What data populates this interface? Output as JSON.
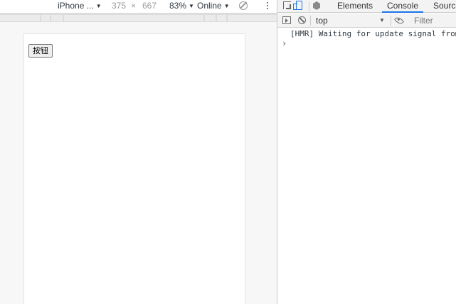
{
  "device_toolbar": {
    "device": "iPhone ...",
    "width": "375",
    "times": "×",
    "height": "667",
    "zoom": "83%",
    "network": "Online"
  },
  "page": {
    "button_label": "按钮"
  },
  "devtools": {
    "tabs": [
      {
        "label": "Elements",
        "active": false
      },
      {
        "label": "Console",
        "active": true
      },
      {
        "label": "Sources",
        "active": false
      }
    ],
    "console_toolbar": {
      "context": "top",
      "filter_placeholder": "Filter"
    },
    "console": {
      "messages": [
        "[HMR] Waiting for update signal from WDS..."
      ],
      "prompt": "›"
    }
  },
  "colors": {
    "accent": "#1a73e8",
    "toolbar_bg": "#f3f3f3",
    "emulation_bg": "#f7f7f7"
  },
  "icons": [
    "rotate-icon",
    "more-icon",
    "inspect-icon",
    "device-mode-icon",
    "cube-icon",
    "sidebar-toggle-icon",
    "clear-console-icon",
    "eye-icon",
    "prompt-chevron-icon"
  ]
}
